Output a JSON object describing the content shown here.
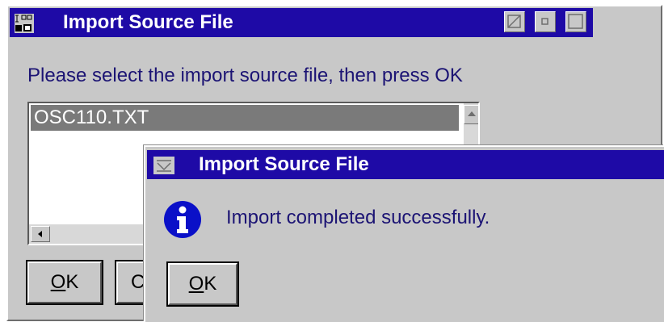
{
  "main_window": {
    "title": "Import Source File",
    "prompt": "Please select the import source file, then press OK",
    "files": [
      "OSC110.TXT"
    ],
    "ok_mnemonic": "O",
    "ok_rest": "K",
    "cancel_visible": "C"
  },
  "message_dialog": {
    "title": "Import Source File",
    "message": "Import completed successfully.",
    "ok_mnemonic": "O",
    "ok_rest": "K"
  },
  "icons": {
    "main_system_menu": "window-icon",
    "dialog_system_menu": "system-menu-icon",
    "message_type": "info-icon"
  },
  "colors": {
    "titlebar": "#1e0aa6",
    "window_face": "#c8c8c8",
    "text_accent": "#1c1474",
    "selection": "#7a7a7a"
  }
}
